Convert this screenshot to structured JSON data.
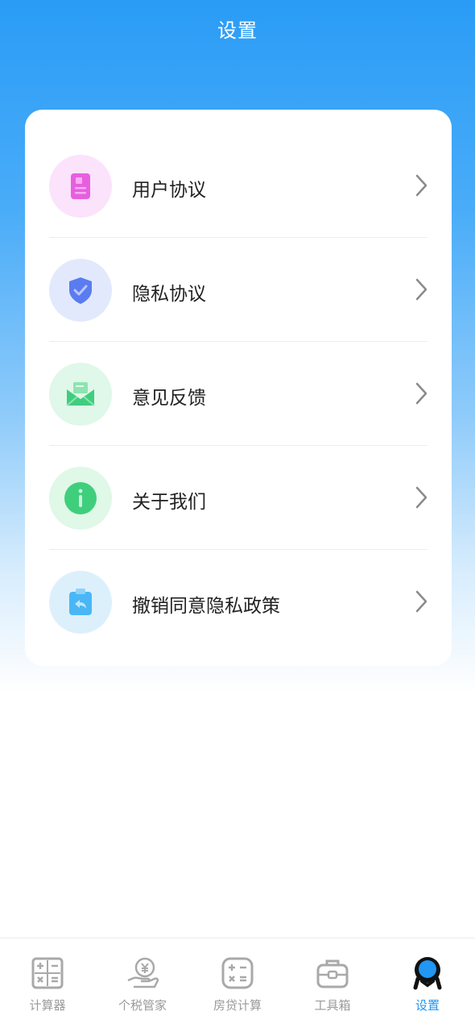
{
  "header": {
    "title": "设置"
  },
  "settings": {
    "items": [
      {
        "label": "用户协议",
        "icon": "document-icon",
        "color": "#e75fe0",
        "bg": "#fbe3fb"
      },
      {
        "label": "隐私协议",
        "icon": "shield-check-icon",
        "color": "#5a7cf0",
        "bg": "#e3e9fc"
      },
      {
        "label": "意见反馈",
        "icon": "envelope-icon",
        "color": "#3fce7e",
        "bg": "#dff8e9"
      },
      {
        "label": "关于我们",
        "icon": "info-icon",
        "color": "#3fcf7c",
        "bg": "#e0f8e7"
      },
      {
        "label": "撤销同意隐私政策",
        "icon": "clipboard-revoke-icon",
        "color": "#49b7f5",
        "bg": "#dcf0fc"
      }
    ]
  },
  "tabbar": {
    "items": [
      {
        "label": "计算器",
        "icon": "calculator-icon",
        "active": false
      },
      {
        "label": "个税管家",
        "icon": "tax-coin-hand-icon",
        "active": false
      },
      {
        "label": "房贷计算",
        "icon": "mortgage-calculator-icon",
        "active": false
      },
      {
        "label": "工具箱",
        "icon": "toolbox-icon",
        "active": false
      },
      {
        "label": "设置",
        "icon": "settings-avatar-icon",
        "active": true
      }
    ]
  },
  "colors": {
    "accent": "#2196f3",
    "header_top": "#2a9cf6",
    "inactive": "#9a9a9a"
  }
}
